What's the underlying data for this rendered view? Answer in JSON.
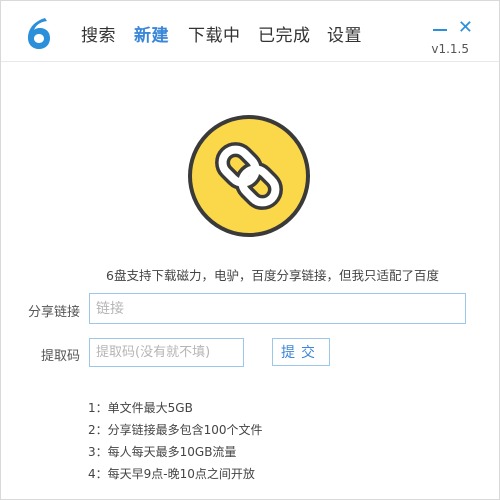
{
  "app": {
    "logo_glyph": "6",
    "brand_color": "#2b8fd9",
    "accent_color": "#3a86d8",
    "version": "v1.1.5"
  },
  "nav": {
    "tabs": [
      {
        "label": "搜索",
        "active": false
      },
      {
        "label": "新建",
        "active": true
      },
      {
        "label": "下载中",
        "active": false
      },
      {
        "label": "已完成",
        "active": false
      },
      {
        "label": "设置",
        "active": false
      }
    ]
  },
  "window_controls": {
    "minimize_icon": "minimize-icon",
    "close_glyph": "✕"
  },
  "hero": {
    "icon": "chain-link-icon",
    "circle_color": "#fbd84a",
    "border_color": "#3a3a3a"
  },
  "main": {
    "description": "6盘支持下载磁力，电驴，百度分享链接，但我只适配了百度",
    "share_link_label": "分享链接",
    "share_link_placeholder": "链接",
    "share_link_value": "",
    "code_label": "提取码",
    "code_placeholder": "提取码(没有就不填)",
    "code_value": "",
    "submit_label": "提交"
  },
  "notes": [
    "1：单文件最大5GB",
    "2：分享链接最多包含100个文件",
    "3：每人每天最多10GB流量",
    "4：每天早9点-晚10点之间开放"
  ]
}
